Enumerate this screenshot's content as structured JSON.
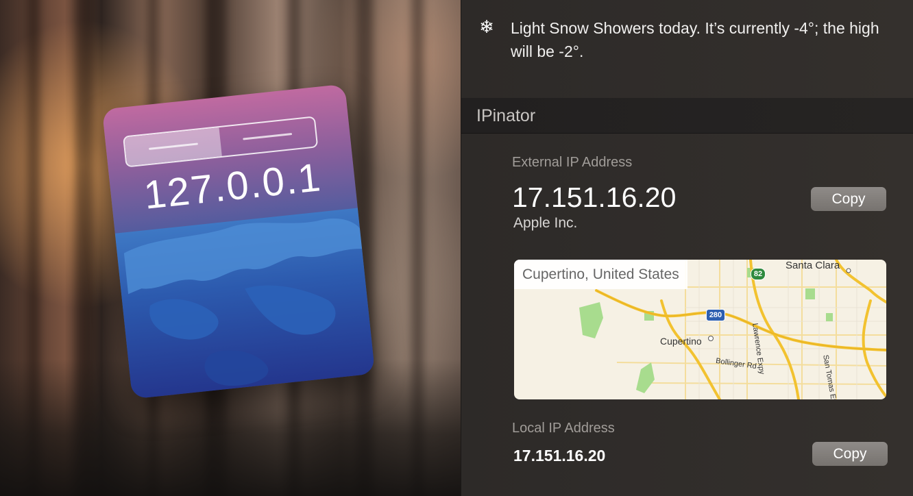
{
  "weather": {
    "icon": "snowflake-icon",
    "icon_glyph": "❄",
    "text": "Light Snow Showers today. It’s currently -4°; the high will be -2°."
  },
  "widget": {
    "title": "IPinator",
    "external": {
      "label": "External IP Address",
      "ip": "17.151.16.20",
      "organization": "Apple Inc.",
      "copy_label": "Copy"
    },
    "map": {
      "location_label": "Cupertino, United States",
      "labels": {
        "santa_clara": "Santa Clara",
        "cupertino": "Cupertino",
        "lawrence_expy": "Lawrence Expy",
        "bollinger_rd": "Bollinger Rd",
        "san_tomas_expy": "San Tomas Exp",
        "shield_280": "280",
        "shield_82": "82"
      }
    },
    "local": {
      "label": "Local IP Address",
      "ip": "17.151.16.20",
      "copy_label": "Copy"
    }
  },
  "app_icon": {
    "ip_text": "127.0.0.1"
  },
  "colors": {
    "panel_bg": "#34302d",
    "button_bg": "#827e7a",
    "map_freeway": "#f2c230",
    "map_park": "#a8dc8e"
  }
}
